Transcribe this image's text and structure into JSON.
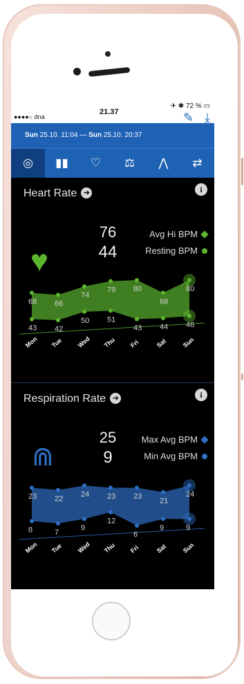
{
  "status": {
    "carrier": "●●●●○ dna",
    "time": "21.37",
    "battery": "72 %"
  },
  "toolbar": {
    "edit_icon": "pencil-icon",
    "download_icon": "download-icon"
  },
  "date_range": {
    "start_day": "Sun",
    "start": "25.10. 11:04",
    "separator": "—",
    "end_day": "Sun",
    "end": "25.10. 20:37"
  },
  "tabs": [
    {
      "icon": "gauge-icon",
      "active": true
    },
    {
      "icon": "bar-chart-icon"
    },
    {
      "icon": "heart-pulse-icon"
    },
    {
      "icon": "scale-icon"
    },
    {
      "icon": "waveform-icon"
    },
    {
      "icon": "export-icon"
    }
  ],
  "colors": {
    "heart": "#5bb52f",
    "respiration": "#2f6fc6",
    "bar": "#1e62b3"
  },
  "heart": {
    "title": "Heart Rate",
    "value_top": "76",
    "value_bottom": "44",
    "legend_top": "Avg Hi BPM",
    "legend_bottom": "Resting BPM"
  },
  "resp": {
    "title": "Respiration Rate",
    "value_top": "25",
    "value_bottom": "9",
    "legend_top": "Max Avg BPM",
    "legend_bottom": "Min Avg BPM"
  },
  "chart_data": [
    {
      "type": "area",
      "title": "Heart Rate",
      "categories": [
        "Mon",
        "Tue",
        "Wed",
        "Thu",
        "Fri",
        "Sat",
        "Sun"
      ],
      "series": [
        {
          "name": "Avg Hi BPM",
          "values": [
            68,
            66,
            74,
            79,
            80,
            68,
            80
          ]
        },
        {
          "name": "Resting BPM",
          "values": [
            43,
            42,
            50,
            51,
            43,
            44,
            46
          ]
        }
      ]
    },
    {
      "type": "area",
      "title": "Respiration Rate",
      "categories": [
        "Mon",
        "Tue",
        "Wed",
        "Thu",
        "Fri",
        "Sat",
        "Sun"
      ],
      "series": [
        {
          "name": "Max Avg BPM",
          "values": [
            23,
            22,
            24,
            23,
            23,
            21,
            24
          ]
        },
        {
          "name": "Min Avg BPM",
          "values": [
            8,
            7,
            9,
            12,
            6,
            9,
            9
          ]
        }
      ]
    }
  ]
}
